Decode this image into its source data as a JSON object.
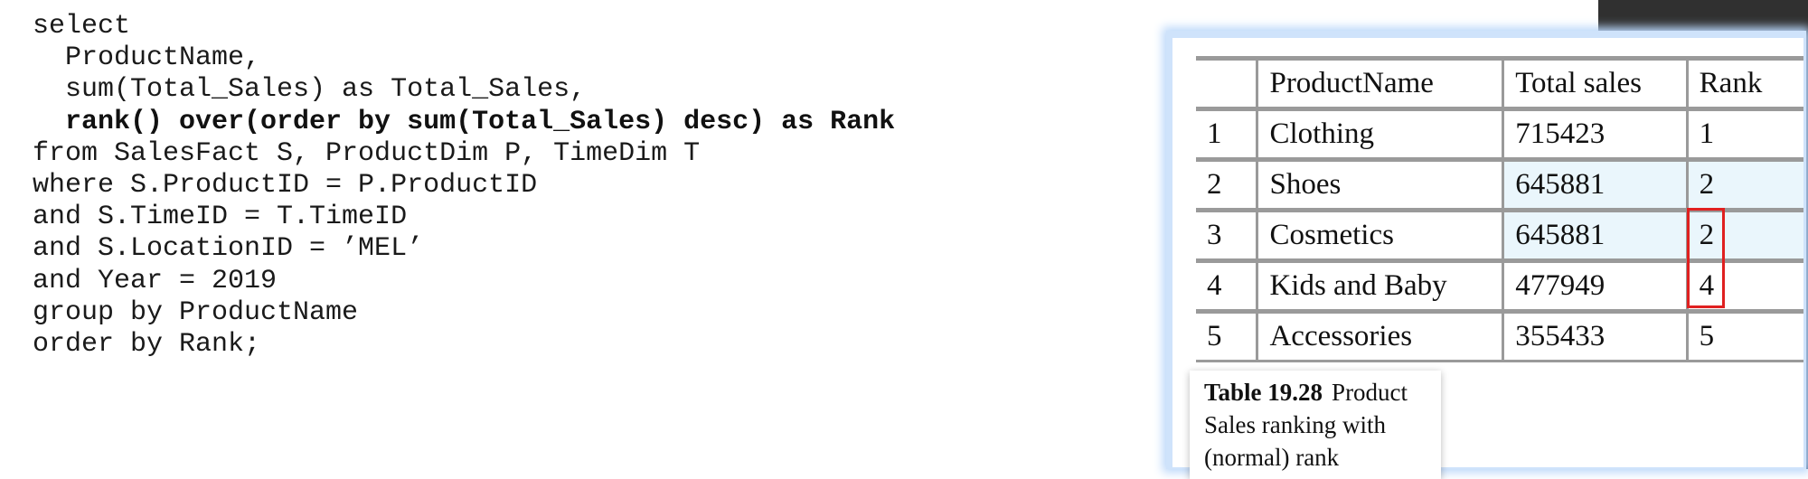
{
  "code": {
    "language": "sql",
    "lines": [
      {
        "text": "select",
        "bold": false
      },
      {
        "text": "  ProductName,",
        "bold": false
      },
      {
        "text": "  sum(Total_Sales) as Total_Sales,",
        "bold": false
      },
      {
        "text": "  rank() over(order by sum(Total_Sales) desc) as Rank",
        "bold": true
      },
      {
        "text": "from SalesFact S, ProductDim P, TimeDim T",
        "bold": false
      },
      {
        "text": "where S.ProductID = P.ProductID",
        "bold": false
      },
      {
        "text": "and S.TimeID = T.TimeID",
        "bold": false
      },
      {
        "text": "and S.LocationID = ’MEL’",
        "bold": false
      },
      {
        "text": "and Year = 2019",
        "bold": false
      },
      {
        "text": "group by ProductName",
        "bold": false
      },
      {
        "text": "order by Rank;",
        "bold": false
      }
    ]
  },
  "result_table": {
    "headers": [
      "",
      "ProductName",
      "Total sales",
      "Rank"
    ],
    "rows": [
      {
        "index": "1",
        "product": "Clothing",
        "total_sales": "715423",
        "rank": "1",
        "highlight": false
      },
      {
        "index": "2",
        "product": "Shoes",
        "total_sales": "645881",
        "rank": "2",
        "highlight": true
      },
      {
        "index": "3",
        "product": "Cosmetics",
        "total_sales": "645881",
        "rank": "2",
        "highlight": true
      },
      {
        "index": "4",
        "product": "Kids and Baby",
        "total_sales": "477949",
        "rank": "4",
        "highlight": false
      },
      {
        "index": "5",
        "product": "Accessories",
        "total_sales": "355433",
        "rank": "5",
        "highlight": false
      }
    ],
    "highlight_color": "#eaf6fc",
    "annotation": {
      "rows": [
        "3",
        "4"
      ],
      "column": "rank",
      "color": "#e02020"
    }
  },
  "caption": {
    "label": "Table 19.28",
    "text": "Product Sales ranking with (normal) rank"
  }
}
